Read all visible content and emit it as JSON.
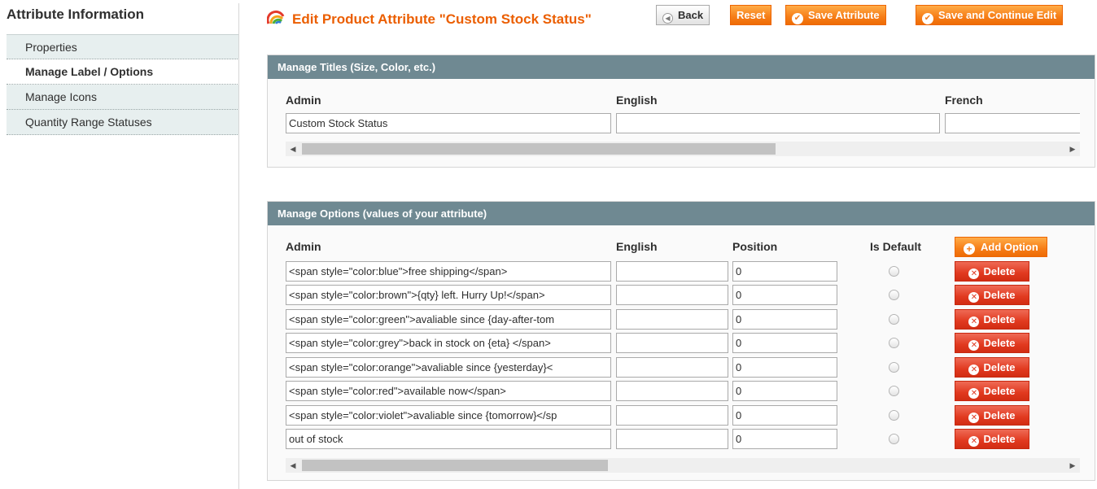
{
  "sidebar": {
    "title": "Attribute Information",
    "items": [
      {
        "label": "Properties"
      },
      {
        "label": "Manage Label / Options"
      },
      {
        "label": "Manage Icons"
      },
      {
        "label": "Quantity Range Statuses"
      }
    ]
  },
  "header": {
    "title": "Edit Product Attribute \"Custom Stock Status\"",
    "buttons": {
      "back": "Back",
      "reset": "Reset",
      "save": "Save Attribute",
      "save_continue": "Save and Continue Edit"
    }
  },
  "titles_panel": {
    "heading": "Manage Titles (Size, Color, etc.)",
    "columns": [
      "Admin",
      "English",
      "French"
    ],
    "values": {
      "admin": "Custom Stock Status",
      "english": "",
      "french": ""
    }
  },
  "options_panel": {
    "heading": "Manage Options (values of your attribute)",
    "columns": {
      "admin": "Admin",
      "english": "English",
      "position": "Position",
      "is_default": "Is Default"
    },
    "add_label": "Add Option",
    "delete_label": "Delete",
    "rows": [
      {
        "admin": "<span style=\"color:blue\">free shipping</span>",
        "english": "",
        "position": "0"
      },
      {
        "admin": "<span style=\"color:brown\">{qty} left. Hurry Up!</span>",
        "english": "",
        "position": "0"
      },
      {
        "admin": "<span style=\"color:green\">avaliable since {day-after-tom",
        "english": "",
        "position": "0"
      },
      {
        "admin": "<span style=\"color:grey\">back in stock on {eta} </span>",
        "english": "",
        "position": "0"
      },
      {
        "admin": "<span style=\"color:orange\">avaliable since {yesterday}<",
        "english": "",
        "position": "0"
      },
      {
        "admin": "<span style=\"color:red\">available now</span>",
        "english": "",
        "position": "0"
      },
      {
        "admin": "<span style=\"color:violet\">avaliable since {tomorrow}</sp",
        "english": "",
        "position": "0"
      },
      {
        "admin": "out of stock",
        "english": "",
        "position": "0"
      }
    ]
  },
  "colors": {
    "accent": "#eb5e00",
    "panel_header": "#6f8992",
    "delete": "#e1391f"
  }
}
